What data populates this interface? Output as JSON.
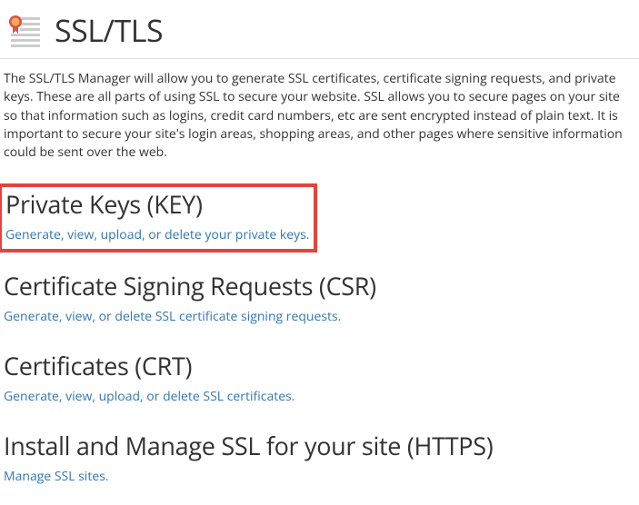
{
  "header": {
    "title": "SSL/TLS"
  },
  "intro": "The SSL/TLS Manager will allow you to generate SSL certificates, certificate signing requests, and private keys. These are all parts of using SSL to secure your website. SSL allows you to secure pages on your site so that information such as logins, credit card numbers, etc are sent encrypted instead of plain text. It is important to secure your site's login areas, shopping areas, and other pages where sensitive information could be sent over the web.",
  "sections": {
    "key": {
      "title": "Private Keys (KEY)",
      "link": "Generate, view, upload, or delete your private keys."
    },
    "csr": {
      "title": "Certificate Signing Requests (CSR)",
      "link": "Generate, view, or delete SSL certificate signing requests."
    },
    "crt": {
      "title": "Certificates (CRT)",
      "link": "Generate, view, upload, or delete SSL certificates."
    },
    "install": {
      "title": "Install and Manage SSL for your site (HTTPS)",
      "link": "Manage SSL sites."
    }
  }
}
